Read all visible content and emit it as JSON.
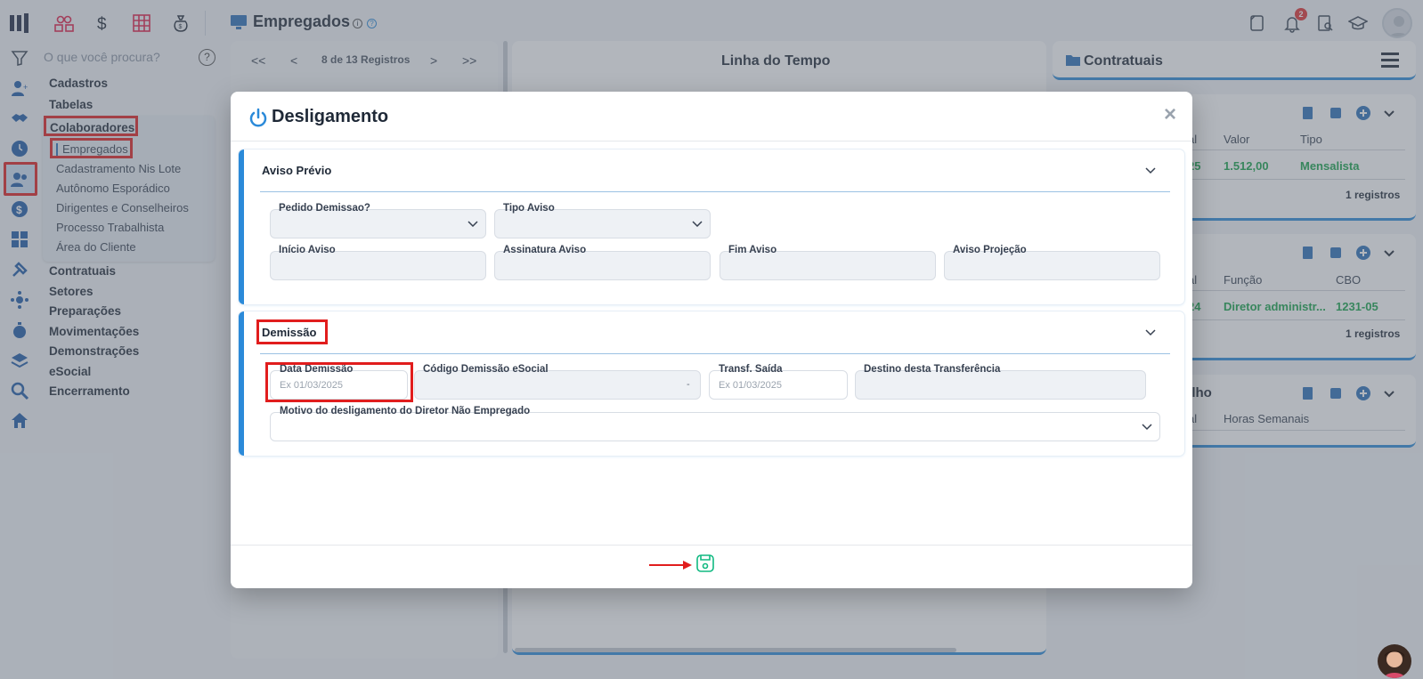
{
  "header": {
    "page_title": "Empregados",
    "notification_count": "2",
    "info_glyph": "i",
    "help_glyph": "?"
  },
  "sidebar": {
    "search_placeholder": "O que você procura?",
    "help_glyph": "?",
    "items": [
      {
        "label": "Cadastros"
      },
      {
        "label": "Tabelas"
      },
      {
        "label": "Colaboradores"
      },
      {
        "label": "Contratuais"
      },
      {
        "label": "Setores"
      },
      {
        "label": "Preparações"
      },
      {
        "label": "Movimentações"
      },
      {
        "label": "Demonstrações"
      },
      {
        "label": "eSocial"
      },
      {
        "label": "Encerramento"
      }
    ],
    "sub_items": [
      {
        "label": "Empregados"
      },
      {
        "label": "Cadastramento Nis Lote"
      },
      {
        "label": "Autônomo Esporádico"
      },
      {
        "label": "Dirigentes e Conselheiros"
      },
      {
        "label": "Processo Trabalhista"
      },
      {
        "label": "Área do Cliente"
      }
    ]
  },
  "pager": {
    "first": "<<",
    "prev": "<",
    "next": ">",
    "last": ">>",
    "text": "8 de 13 Registros"
  },
  "timeline": {
    "title": "Linha do Tempo"
  },
  "contratuais": {
    "title": "Contratuais",
    "card1": {
      "col_a": "al",
      "col_b": "Valor",
      "col_c": "Tipo",
      "val_a": "25",
      "val_b": "1.512,00",
      "val_c": "Mensalista",
      "count": "1 registros"
    },
    "card2": {
      "col_a": "al",
      "col_b": "Função",
      "col_c": "CBO",
      "val_a": "24",
      "val_b": "Diretor administr...",
      "val_c": "1231-05",
      "count": "1 registros"
    },
    "card3": {
      "title": "alho",
      "col_a": "al",
      "col_b": "Horas Semanais"
    }
  },
  "modal": {
    "title": "Desligamento",
    "close": "×",
    "aviso": {
      "title": "Aviso Prévio",
      "pedido_demissao": "Pedido Demissao?",
      "tipo_aviso": "Tipo Aviso",
      "inicio_aviso": "Início Aviso",
      "assinatura_aviso": "Assinatura Aviso",
      "fim_aviso": "Fim Aviso",
      "aviso_projecao": "Aviso Projeção"
    },
    "demissao": {
      "title": "Demissão",
      "data_demissao": "Data Demissão",
      "data_demissao_placeholder": "Ex 01/03/2025",
      "codigo_esocial": "Código Demissão eSocial",
      "codigo_esocial_value": "-",
      "transf_saida": "Transf. Saída",
      "transf_saida_placeholder": "Ex 01/03/2025",
      "destino": "Destino desta Transferência",
      "motivo": "Motivo do desligamento do Diretor Não Empregado"
    }
  },
  "colors": {
    "accent": "#2b8ad9",
    "highlight": "#e11d1d",
    "success": "#16a34a",
    "save": "#10b981"
  }
}
